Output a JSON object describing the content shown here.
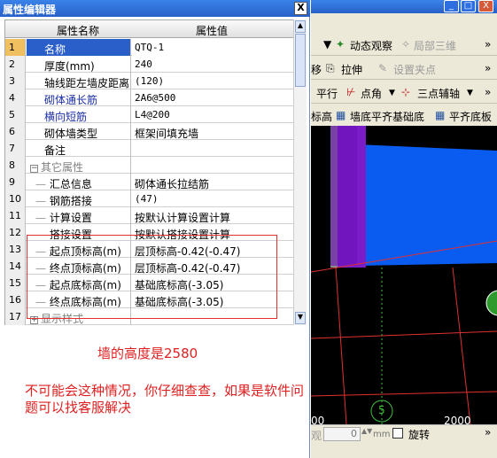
{
  "window": {
    "title": "属性编辑器",
    "close_glyph": "X"
  },
  "grid": {
    "col_name": "属性名称",
    "col_value": "属性值",
    "rows": [
      {
        "num": "1",
        "name": "名称",
        "value": "QTQ-1"
      },
      {
        "num": "2",
        "name": "厚度(mm)",
        "value": "240"
      },
      {
        "num": "3",
        "name": "轴线距左墙皮距离",
        "value": "(120)"
      },
      {
        "num": "4",
        "name": "砌体通长筋",
        "value": "2A6@500"
      },
      {
        "num": "5",
        "name": "横向短筋",
        "value": "L4@200"
      },
      {
        "num": "6",
        "name": "砌体墙类型",
        "value": "框架间填充墙"
      },
      {
        "num": "7",
        "name": "备注",
        "value": ""
      },
      {
        "num": "8",
        "name": "其它属性",
        "value": ""
      },
      {
        "num": "9",
        "name": "汇总信息",
        "value": "砌体通长拉结筋"
      },
      {
        "num": "10",
        "name": "钢筋搭接",
        "value": "(47)"
      },
      {
        "num": "11",
        "name": "计算设置",
        "value": "按默认计算设置计算"
      },
      {
        "num": "12",
        "name": "搭接设置",
        "value": "按默认搭接设置计算"
      },
      {
        "num": "13",
        "name": "起点顶标高(m)",
        "value": "层顶标高-0.42(-0.47)"
      },
      {
        "num": "14",
        "name": "终点顶标高(m)",
        "value": "层顶标高-0.42(-0.47)"
      },
      {
        "num": "15",
        "name": "起点底标高(m)",
        "value": "基础底标高(-3.05)"
      },
      {
        "num": "16",
        "name": "终点底标高(m)",
        "value": "基础底标高(-3.05)"
      },
      {
        "num": "17",
        "name": "显示样式",
        "value": ""
      }
    ]
  },
  "notes": {
    "height": "墙的高度是2580",
    "advice": "不可能会这种情况，你仔细查查，如果是软件问题可以找客服解决"
  },
  "right_window": {
    "min_glyph": "_",
    "max_glyph": "□",
    "close_glyph": "X",
    "toolbar1": {
      "dynamic_view": "动态观察",
      "partial_3d": "局部三维",
      "more": "»"
    },
    "toolbar2": {
      "move": "移",
      "stretch": "拉伸",
      "set_point": "设置夹点",
      "more": "»"
    },
    "toolbar3": {
      "parallel": "平行",
      "point_angle": "点角",
      "three_point_axis": "三点辅轴",
      "more": "»"
    },
    "toolbar4": {
      "elev": "标高",
      "wall_bottom_flush": "墙底平齐基础底",
      "flush_slab_bottom": "平齐底板"
    },
    "scene": {
      "axis_label": "5",
      "dim_left": "00",
      "dim_right": "2000"
    },
    "status": {
      "left": "观",
      "spin_value": "0",
      "unit": "mm",
      "rotate": "旋转",
      "more": "»"
    }
  },
  "colors": {
    "title_blue": "#2760c9",
    "selected_row": "#2a5ec9",
    "annotation_red": "#e02020",
    "wall_blue": "#0a5cf0",
    "column_purple": "#7a1cc8"
  }
}
